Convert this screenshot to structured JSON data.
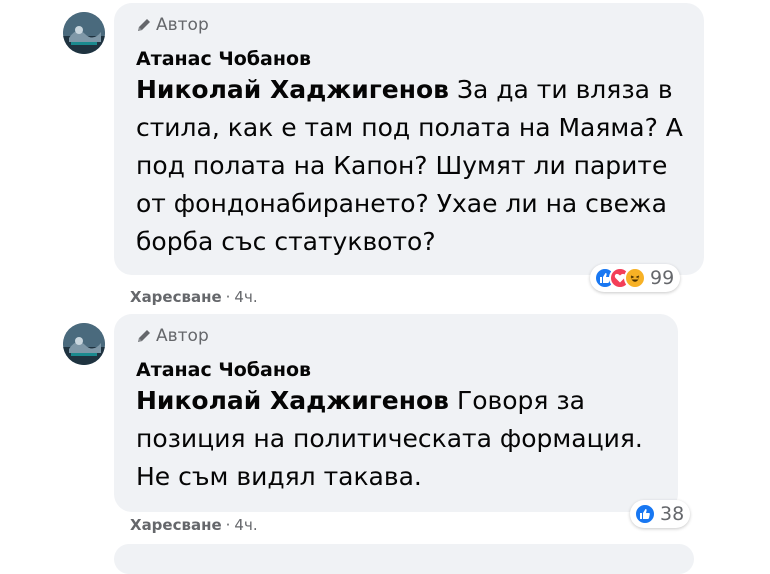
{
  "comments": [
    {
      "badge": "Автор",
      "author": "Атанас Чобанов",
      "mention": "Николай Хаджигенов",
      "text": " За да ти вляза в стила, как е там под полата на Маяма? А под полата на Капон? Шумят ли парите от фондонабирането? Ухае ли на свежа борба със статуквото?",
      "reactions": [
        "like-icon",
        "love-icon",
        "haha-icon"
      ],
      "reaction_count": "99",
      "like_label": "Харесване",
      "separator": "·",
      "time": "4ч."
    },
    {
      "badge": "Автор",
      "author": "Атанас Чобанов",
      "mention": "Николай Хаджигенов",
      "text": " Говоря за позиция на политическата формация. Не съм видял такава.",
      "reactions": [
        "like-icon"
      ],
      "reaction_count": "38",
      "like_label": "Харесване",
      "separator": "·",
      "time": "4ч."
    }
  ],
  "colors": {
    "bubble": "#f0f2f5",
    "secondary_text": "#65676b",
    "like": "#1877f2",
    "love": "#f33e58",
    "haha": "#f7b125"
  }
}
